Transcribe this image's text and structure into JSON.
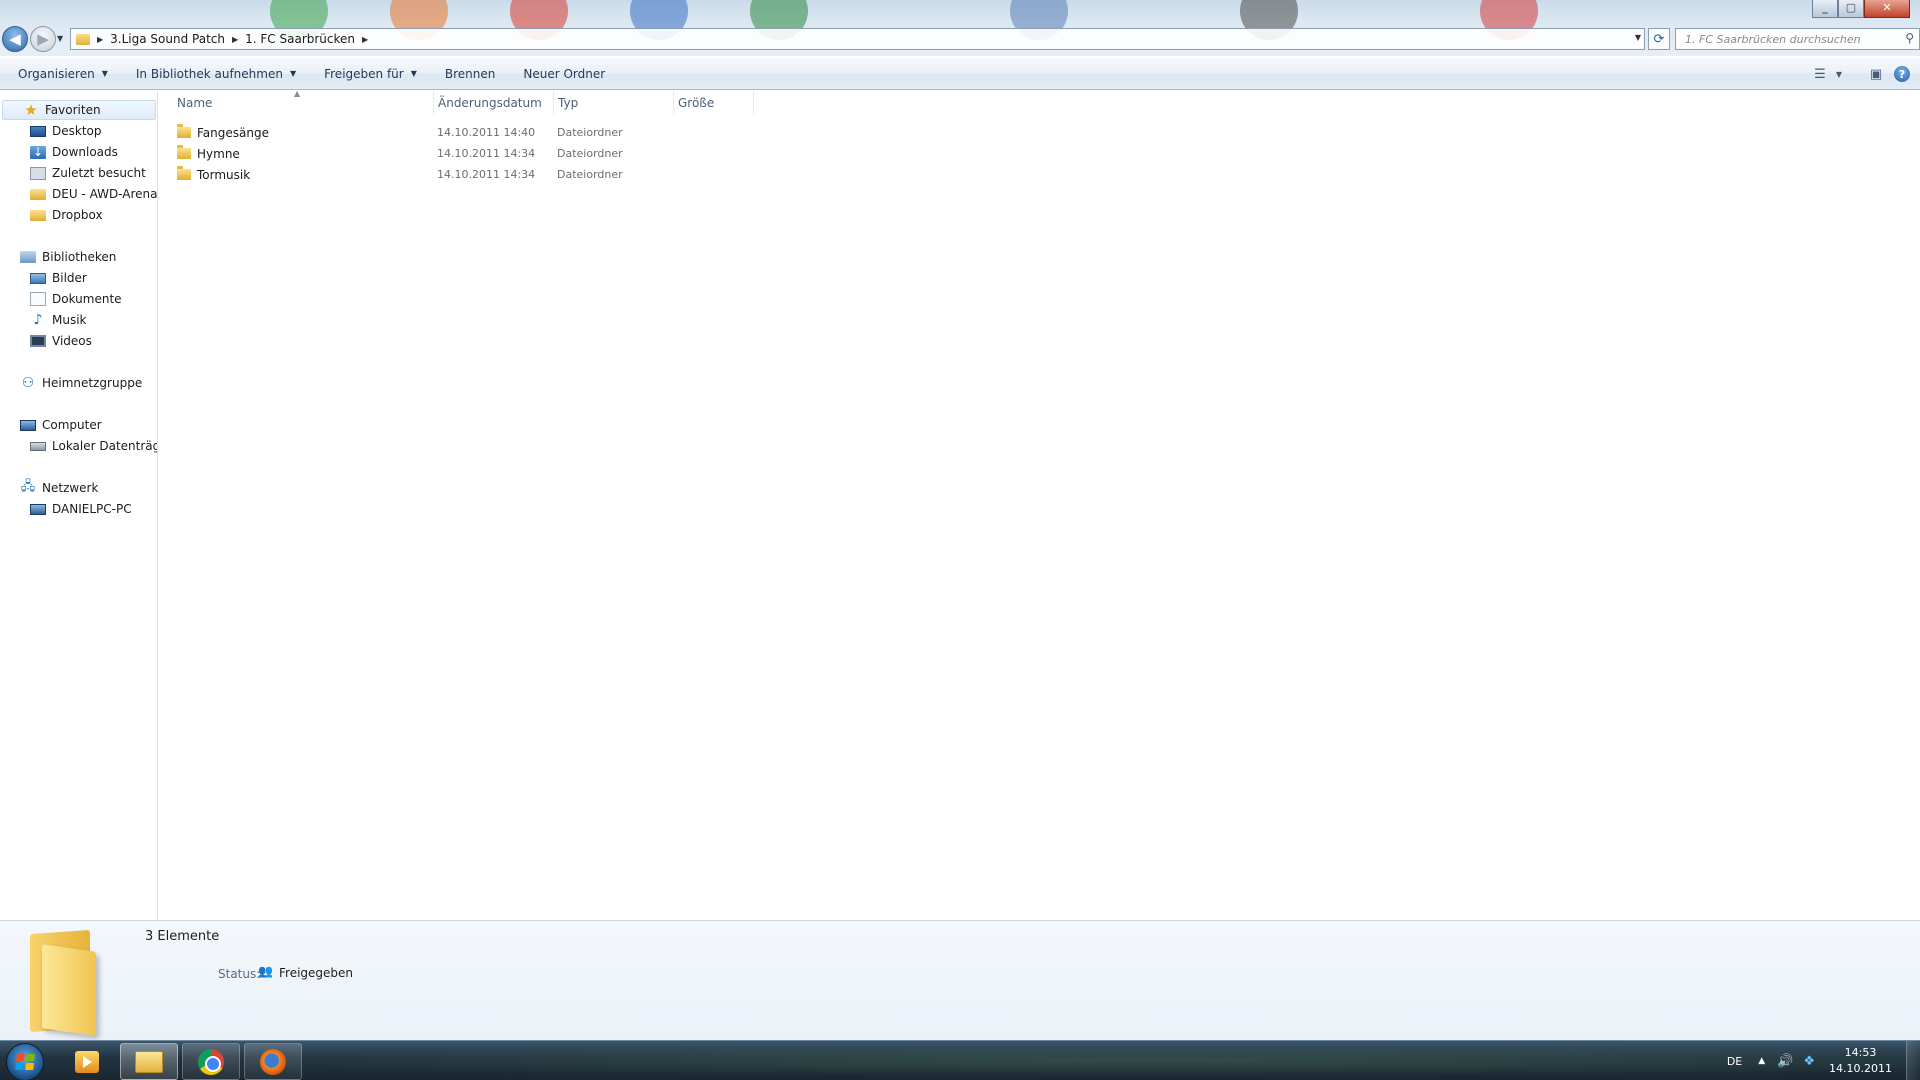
{
  "window": {
    "controls": {
      "minimize": "_",
      "maximize": "▢",
      "close": "✕"
    }
  },
  "address": {
    "breadcrumbs": [
      "3.Liga Sound Patch",
      "1. FC Saarbrücken"
    ],
    "search_placeholder": "1. FC Saarbrücken durchsuchen"
  },
  "commandbar": {
    "organize": "Organisieren",
    "include_library": "In Bibliothek aufnehmen",
    "share_with": "Freigeben für",
    "burn": "Brennen",
    "new_folder": "Neuer Ordner"
  },
  "navpane": {
    "favorites": {
      "label": "Favoriten",
      "items": [
        "Desktop",
        "Downloads",
        "Zuletzt besucht",
        "DEU - AWD-Arena, H",
        "Dropbox"
      ]
    },
    "libraries": {
      "label": "Bibliotheken",
      "items": [
        "Bilder",
        "Dokumente",
        "Musik",
        "Videos"
      ]
    },
    "homegroup": {
      "label": "Heimnetzgruppe"
    },
    "computer": {
      "label": "Computer",
      "items": [
        "Lokaler Datenträger"
      ]
    },
    "network": {
      "label": "Netzwerk",
      "items": [
        "DANIELPC-PC"
      ]
    }
  },
  "filelist": {
    "columns": [
      "Name",
      "Änderungsdatum",
      "Typ",
      "Größe"
    ],
    "rows": [
      {
        "name": "Fangesänge",
        "date": "14.10.2011 14:40",
        "type": "Dateiordner"
      },
      {
        "name": "Hymne",
        "date": "14.10.2011 14:34",
        "type": "Dateiordner"
      },
      {
        "name": "Tormusik",
        "date": "14.10.2011 14:34",
        "type": "Dateiordner"
      }
    ]
  },
  "details": {
    "count": "3 Elemente",
    "status_label": "Status:",
    "status_value": "Freigegeben"
  },
  "taskbar": {
    "apps": [
      "media-player",
      "windows-explorer",
      "google-chrome",
      "firefox"
    ],
    "language": "DE",
    "time": "14:53",
    "date": "14.10.2011"
  }
}
